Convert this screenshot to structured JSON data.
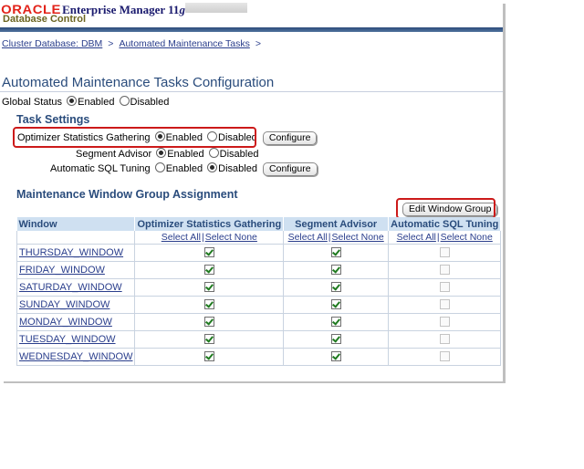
{
  "header": {
    "brand": "ORACLE",
    "product": "Enterprise Manager 11",
    "version": "g",
    "subtitle": "Database Control"
  },
  "breadcrumb": {
    "items": [
      {
        "label": "Cluster Database: DBM"
      },
      {
        "label": "Automated Maintenance Tasks"
      }
    ],
    "separator": ">"
  },
  "page": {
    "title": "Automated Maintenance Tasks Configuration"
  },
  "global_status": {
    "label": "Global Status",
    "options": [
      "Enabled",
      "Disabled"
    ],
    "selected": "Enabled"
  },
  "task_settings": {
    "heading": "Task Settings",
    "rows": [
      {
        "label": "Optimizer Statistics Gathering",
        "options": [
          "Enabled",
          "Disabled"
        ],
        "selected": "Enabled",
        "button": "Configure"
      },
      {
        "label": "Segment Advisor",
        "options": [
          "Enabled",
          "Disabled"
        ],
        "selected": "Enabled"
      },
      {
        "label": "Automatic SQL Tuning",
        "options": [
          "Enabled",
          "Disabled"
        ],
        "selected": "Disabled",
        "button": "Configure"
      }
    ]
  },
  "window_group": {
    "heading": "Maintenance Window Group Assignment",
    "edit_button": "Edit Window Group",
    "columns": [
      "Window",
      "Optimizer Statistics Gathering",
      "Segment Advisor",
      "Automatic SQL Tuning"
    ],
    "select_all": "Select All",
    "select_none": "Select None",
    "rows": [
      {
        "window": "THURSDAY_WINDOW",
        "optimizer": true,
        "segment": true,
        "sql_tuning": false
      },
      {
        "window": "FRIDAY_WINDOW",
        "optimizer": true,
        "segment": true,
        "sql_tuning": false
      },
      {
        "window": "SATURDAY_WINDOW",
        "optimizer": true,
        "segment": true,
        "sql_tuning": false
      },
      {
        "window": "SUNDAY_WINDOW",
        "optimizer": true,
        "segment": true,
        "sql_tuning": false
      },
      {
        "window": "MONDAY_WINDOW",
        "optimizer": true,
        "segment": true,
        "sql_tuning": false
      },
      {
        "window": "TUESDAY_WINDOW",
        "optimizer": true,
        "segment": true,
        "sql_tuning": false
      },
      {
        "window": "WEDNESDAY_WINDOW",
        "optimizer": true,
        "segment": true,
        "sql_tuning": false
      }
    ]
  },
  "colors": {
    "accent": "#2a4c7c",
    "link": "#2a3e8c",
    "brand_red": "#e2231a",
    "highlight": "#cc1a1a",
    "table_header": "#cfe0f1"
  }
}
